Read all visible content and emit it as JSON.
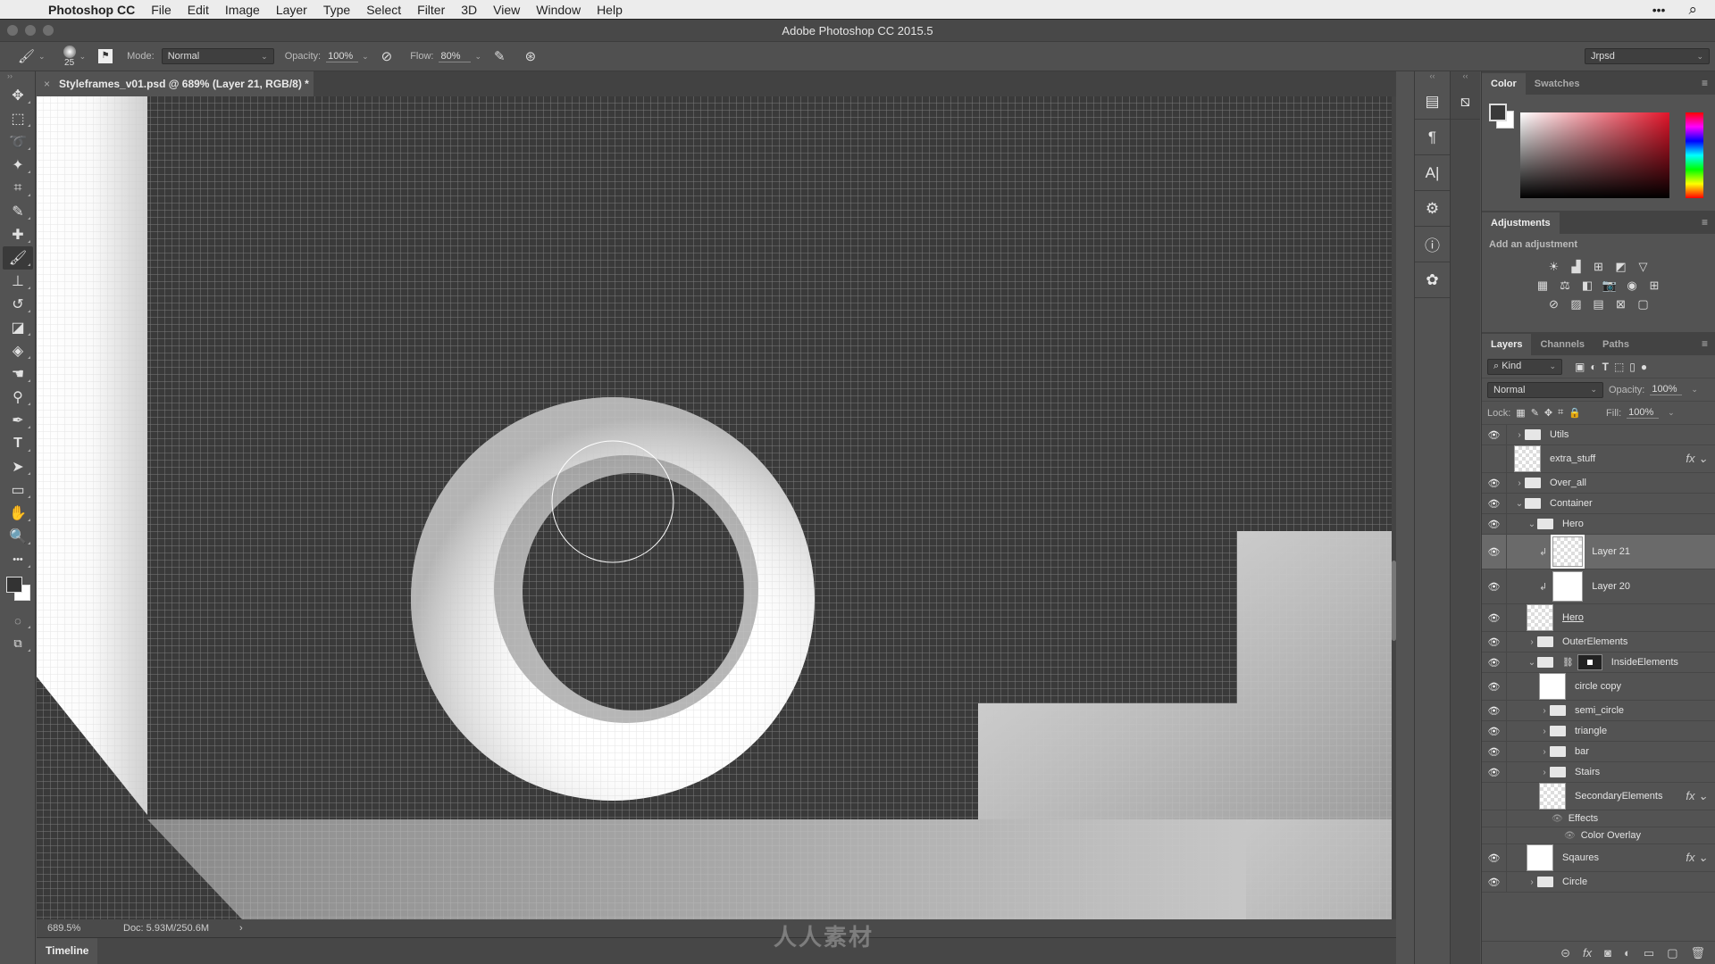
{
  "menubar": {
    "app_name": "Photoshop CC",
    "items": [
      "File",
      "Edit",
      "Image",
      "Layer",
      "Type",
      "Select",
      "Filter",
      "3D",
      "View",
      "Window",
      "Help"
    ],
    "more_icon": "•••",
    "search_icon": "⌕"
  },
  "window": {
    "title": "Adobe Photoshop CC 2015.5"
  },
  "options_bar": {
    "brush_size": "25",
    "mode_label": "Mode:",
    "mode_value": "Normal",
    "opacity_label": "Opacity:",
    "opacity_value": "100%",
    "flow_label": "Flow:",
    "flow_value": "80%",
    "workspace_value": "Jrpsd"
  },
  "document": {
    "tab_title": "Styleframes_v01.psd @ 689% (Layer 21, RGB/8) *",
    "close_icon": "×",
    "zoom_level": "689.5%",
    "doc_size": "Doc: 5.93M/250.6M",
    "status_arrow": "›"
  },
  "timeline": {
    "label": "Timeline"
  },
  "tools": [
    {
      "name": "move-tool",
      "glyph": "✥"
    },
    {
      "name": "marquee-tool",
      "glyph": "⬚"
    },
    {
      "name": "lasso-tool",
      "glyph": "➰"
    },
    {
      "name": "magic-wand-tool",
      "glyph": "✦"
    },
    {
      "name": "crop-tool",
      "glyph": "⌗"
    },
    {
      "name": "eyedropper-tool",
      "glyph": "✎"
    },
    {
      "name": "healing-brush-tool",
      "glyph": "✚"
    },
    {
      "name": "brush-tool",
      "glyph": "🖌"
    },
    {
      "name": "clone-stamp-tool",
      "glyph": "⊥"
    },
    {
      "name": "history-brush-tool",
      "glyph": "↺"
    },
    {
      "name": "eraser-tool",
      "glyph": "◪"
    },
    {
      "name": "paint-bucket-tool",
      "glyph": "◈"
    },
    {
      "name": "smudge-tool",
      "glyph": "☚"
    },
    {
      "name": "dodge-tool",
      "glyph": "⚲"
    },
    {
      "name": "pen-tool",
      "glyph": "✒"
    },
    {
      "name": "type-tool",
      "glyph": "T"
    },
    {
      "name": "path-selection-tool",
      "glyph": "➤"
    },
    {
      "name": "rectangle-tool",
      "glyph": "▭"
    },
    {
      "name": "hand-tool",
      "glyph": "✋"
    },
    {
      "name": "zoom-tool",
      "glyph": "🔍"
    },
    {
      "name": "more-tools",
      "glyph": "•••"
    }
  ],
  "dock_icons": [
    "▤",
    "¶",
    "A|",
    "⚙",
    "ⓘ",
    "✿"
  ],
  "dock2_icons": [
    "⧅"
  ],
  "color_panel": {
    "tabs": [
      "Color",
      "Swatches"
    ],
    "active_tab": "Color",
    "foreground": "#3a3a3a",
    "background": "#ffffff",
    "hue": "#e2152a"
  },
  "adjustments_panel": {
    "title": "Adjustments",
    "subtitle": "Add an adjustment",
    "rows": [
      [
        "☀",
        "▟",
        "⊞",
        "◩",
        "▽"
      ],
      [
        "▦",
        "⚖",
        "◧",
        "📷",
        "◉",
        "⊞"
      ],
      [
        "⊘",
        "▨",
        "▤",
        "⊠",
        "▢"
      ]
    ]
  },
  "layers_panel": {
    "tabs": [
      "Layers",
      "Channels",
      "Paths"
    ],
    "active_tab": "Layers",
    "filter_label": "Kind",
    "blend_mode": "Normal",
    "opacity_label": "Opacity:",
    "opacity_value": "100%",
    "lock_label": "Lock:",
    "fill_label": "Fill:",
    "fill_value": "100%",
    "layers": [
      {
        "name": "Utils",
        "type": "folder",
        "indent": 0,
        "visible": true,
        "expanded": false
      },
      {
        "name": "extra_stuff",
        "type": "smart",
        "indent": 0,
        "visible": false,
        "fx": true
      },
      {
        "name": "Over_all",
        "type": "folder",
        "indent": 0,
        "visible": true,
        "expanded": false
      },
      {
        "name": "Container",
        "type": "folder",
        "indent": 0,
        "visible": true,
        "expanded": true
      },
      {
        "name": "Hero",
        "type": "folder",
        "indent": 1,
        "visible": true,
        "expanded": true
      },
      {
        "name": "Layer 21",
        "type": "layer",
        "indent": 2,
        "visible": true,
        "selected": true,
        "clipped": true
      },
      {
        "name": "Layer 20",
        "type": "layer",
        "indent": 2,
        "visible": true,
        "clipped": true,
        "white": true
      },
      {
        "name": "Hero",
        "type": "smart",
        "indent": 1,
        "visible": true,
        "underline": true
      },
      {
        "name": "OuterElements",
        "type": "folder",
        "indent": 1,
        "visible": true,
        "expanded": false
      },
      {
        "name": "InsideElements",
        "type": "folder",
        "indent": 1,
        "visible": true,
        "expanded": true,
        "mask": true
      },
      {
        "name": "circle copy",
        "type": "smart",
        "indent": 2,
        "visible": true,
        "white": true
      },
      {
        "name": "semi_circle",
        "type": "folder",
        "indent": 2,
        "visible": true,
        "expanded": false
      },
      {
        "name": "triangle",
        "type": "folder",
        "indent": 2,
        "visible": true,
        "expanded": false
      },
      {
        "name": "bar",
        "type": "folder",
        "indent": 2,
        "visible": true,
        "expanded": false
      },
      {
        "name": "Stairs",
        "type": "folder",
        "indent": 2,
        "visible": true,
        "expanded": false
      },
      {
        "name": "SecondaryElements",
        "type": "smart",
        "indent": 2,
        "visible": false,
        "fx": true
      },
      {
        "name": "Effects",
        "type": "effect",
        "indent": 3,
        "visible": true
      },
      {
        "name": "Color Overlay",
        "type": "effect",
        "indent": 4,
        "visible": true
      },
      {
        "name": "Sqaures",
        "type": "smart",
        "indent": 1,
        "visible": true,
        "fx": true,
        "white": true
      },
      {
        "name": "Circle",
        "type": "folder",
        "indent": 1,
        "visible": true,
        "expanded": false
      }
    ],
    "footer_icons": [
      "⊝",
      "fx",
      "◙",
      "◐",
      "▭",
      "▢",
      "🗑"
    ]
  },
  "watermark": "人人素材"
}
